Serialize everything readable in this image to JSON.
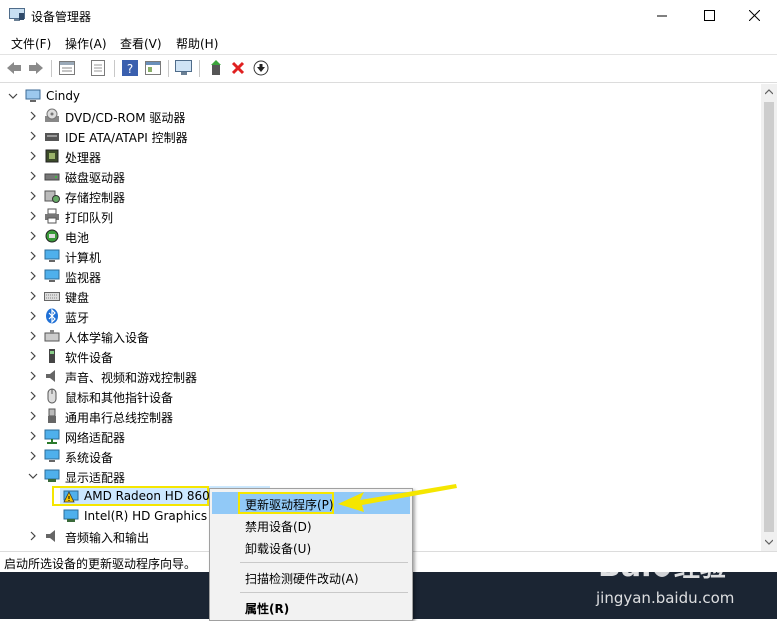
{
  "window": {
    "title": "设备管理器"
  },
  "menubar": [
    "文件(F)",
    "操作(A)",
    "查看(V)",
    "帮助(H)"
  ],
  "toolbar": {
    "icons": [
      "back-icon",
      "forward-icon",
      "properties-icon",
      "help-icon",
      "update-driver-icon",
      "scan-hardware-icon",
      "enable-device-icon",
      "uninstall-icon",
      "download-icon"
    ]
  },
  "tree": {
    "root": "Cindy",
    "categories": [
      "DVD/CD-ROM 驱动器",
      "IDE ATA/ATAPI 控制器",
      "处理器",
      "磁盘驱动器",
      "存储控制器",
      "打印队列",
      "电池",
      "计算机",
      "监视器",
      "键盘",
      "蓝牙",
      "人体学输入设备",
      "软件设备",
      "声音、视频和游戏控制器",
      "鼠标和其他指针设备",
      "通用串行总线控制器",
      "网络适配器",
      "系统设备",
      "显示适配器"
    ],
    "display_children": [
      "AMD Radeon HD 860",
      "Intel(R) HD Graphics F"
    ],
    "after": "音频输入和输出"
  },
  "status": {
    "text": "启动所选设备的更新驱动程序向导。"
  },
  "context_menu": {
    "items": [
      "更新驱动程序(P)",
      "禁用设备(D)",
      "卸载设备(U)",
      "扫描检测硬件改动(A)",
      "属性(R)"
    ]
  },
  "watermark": {
    "text": "jingyan.baidu.com"
  },
  "colors": {
    "highlight": "#f5e600",
    "selection": "#cce8ff",
    "menu_hover": "#91c9f7"
  }
}
